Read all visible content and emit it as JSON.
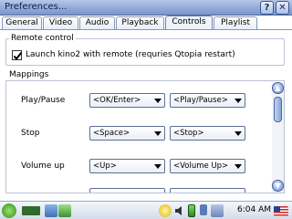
{
  "window": {
    "title": "Preferences...",
    "help_label": "?",
    "close_label": "✕"
  },
  "tabs": [
    {
      "label": "General"
    },
    {
      "label": "Video"
    },
    {
      "label": "Audio"
    },
    {
      "label": "Playback"
    },
    {
      "label": "Controls"
    },
    {
      "label": "Playlist"
    }
  ],
  "active_tab": "Controls",
  "remote": {
    "group_title": "Remote control",
    "checkbox_label": "Launch kino2 with remote (requries Qtopia restart)",
    "checked": true
  },
  "mappings": {
    "group_title": "Mappings",
    "rows": [
      {
        "label": "Play/Pause",
        "key": "<OK/Enter>",
        "action": "<Play/Pause>"
      },
      {
        "label": "Stop",
        "key": "<Space>",
        "action": "<Stop>"
      },
      {
        "label": "Volume up",
        "key": "<Up>",
        "action": "<Volume Up>"
      }
    ]
  },
  "scrollbar": {
    "up_label": "▲",
    "down_label": "▼"
  },
  "taskbar": {
    "time": "6:04 AM",
    "icons": [
      "start-icon",
      "app-icon",
      "window-icon",
      "network-icon",
      "bulb-icon",
      "speaker-icon",
      "battery-icon",
      "monitor-icon",
      "flag-icon"
    ]
  }
}
